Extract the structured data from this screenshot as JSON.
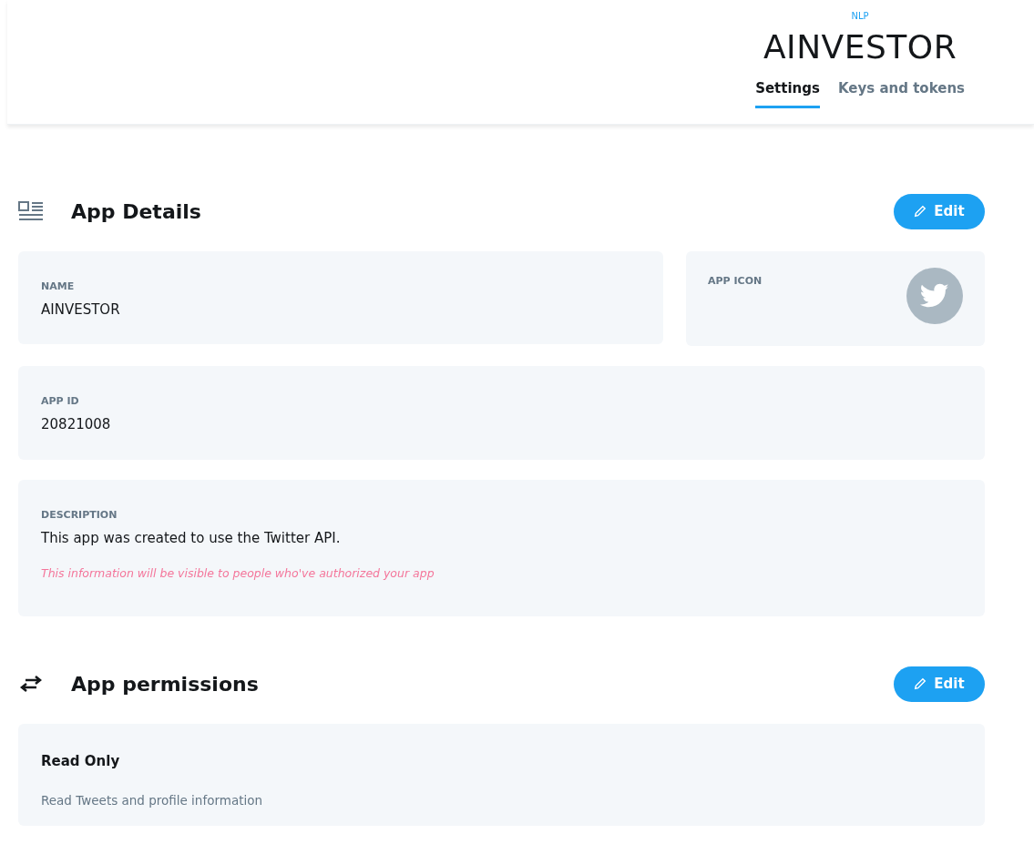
{
  "header": {
    "overline": "NLP",
    "title": "AINVESTOR",
    "tabs": [
      {
        "label": "Settings",
        "selected": true
      },
      {
        "label": "Keys and tokens",
        "selected": false
      }
    ]
  },
  "app_details": {
    "title": "App Details",
    "edit_label": "Edit",
    "name": {
      "label": "NAME",
      "value": "AINVESTOR"
    },
    "app_icon": {
      "label": "APP ICON"
    },
    "app_id": {
      "label": "APP ID",
      "value": "20821008"
    },
    "description": {
      "label": "DESCRIPTION",
      "value": "This app was created to use the Twitter API.",
      "note": "This information will be visible to people who've authorized your app"
    }
  },
  "app_permissions": {
    "title": "App permissions",
    "edit_label": "Edit",
    "permission": "Read Only",
    "detail": "Read Tweets and profile information"
  }
}
